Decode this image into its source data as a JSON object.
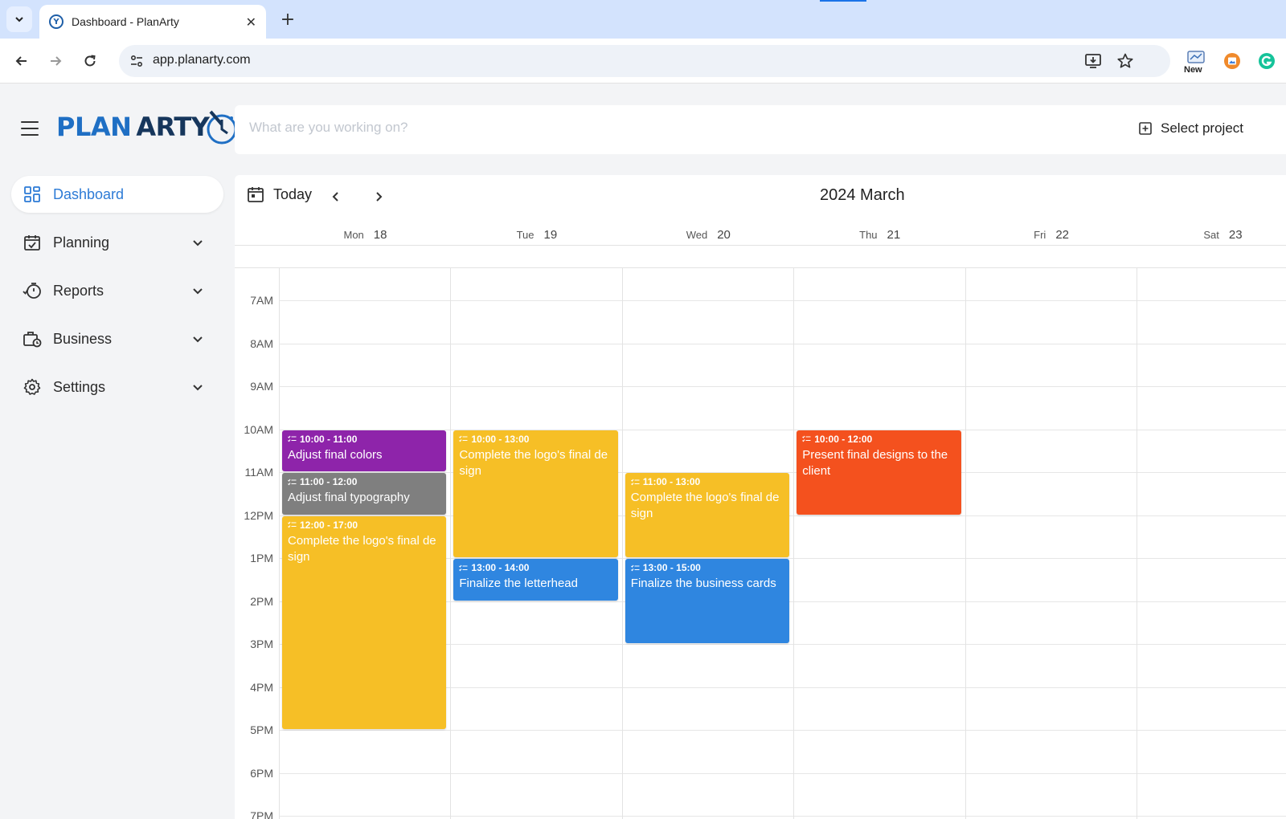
{
  "browser": {
    "tab_title": "Dashboard - PlanArty",
    "tab_favicon_letter": "Y",
    "url": "app.planarty.com",
    "ext_new_label": "New"
  },
  "app": {
    "logo_part1": "PLAN",
    "logo_part2": "ARTY",
    "search_placeholder": "What are you working on?",
    "select_project_label": "Select project",
    "nav": [
      {
        "label": "Dashboard",
        "icon": "dashboard-grid-icon",
        "active": true
      },
      {
        "label": "Planning",
        "icon": "calendar-check-icon",
        "expandable": true
      },
      {
        "label": "Reports",
        "icon": "timer-report-icon",
        "expandable": true
      },
      {
        "label": "Business",
        "icon": "briefcase-clock-icon",
        "expandable": true
      },
      {
        "label": "Settings",
        "icon": "gear-icon",
        "expandable": true
      }
    ]
  },
  "calendar": {
    "today_label": "Today",
    "title": "2024 March",
    "days": [
      {
        "name": "Mon",
        "num": "18"
      },
      {
        "name": "Tue",
        "num": "19"
      },
      {
        "name": "Wed",
        "num": "20"
      },
      {
        "name": "Thu",
        "num": "21"
      },
      {
        "name": "Fri",
        "num": "22"
      },
      {
        "name": "Sat",
        "num": "23"
      }
    ],
    "hours": [
      "7AM",
      "8AM",
      "9AM",
      "10AM",
      "11AM",
      "12PM",
      "1PM",
      "2PM",
      "3PM",
      "4PM",
      "5PM",
      "6PM",
      "7PM"
    ],
    "first_hour": 7,
    "events": [
      {
        "day": 0,
        "start": 10,
        "end": 11,
        "time": "10:00 - 11:00",
        "title": "Adjust final colors",
        "color": "#8e24aa"
      },
      {
        "day": 0,
        "start": 11,
        "end": 12,
        "time": "11:00 - 12:00",
        "title": "Adjust final typography",
        "color": "#7f7f7f"
      },
      {
        "day": 0,
        "start": 12,
        "end": 17,
        "time": "12:00 - 17:00",
        "title": "Complete the logo's final de sign",
        "color": "#f6bf26"
      },
      {
        "day": 1,
        "start": 10,
        "end": 13,
        "time": "10:00 - 13:00",
        "title": "Complete the logo's final de sign",
        "color": "#f6bf26"
      },
      {
        "day": 1,
        "start": 13,
        "end": 14,
        "time": "13:00 - 14:00",
        "title": "Finalize the letterhead",
        "color": "#2f86e0"
      },
      {
        "day": 2,
        "start": 11,
        "end": 13,
        "time": "11:00 - 13:00",
        "title": "Complete the logo's final de sign",
        "color": "#f6bf26"
      },
      {
        "day": 2,
        "start": 13,
        "end": 15,
        "time": "13:00 - 15:00",
        "title": "Finalize the business cards",
        "color": "#2f86e0"
      },
      {
        "day": 3,
        "start": 10,
        "end": 12,
        "time": "10:00 - 12:00",
        "title": "Present final designs to the client",
        "color": "#f4511e"
      }
    ]
  }
}
